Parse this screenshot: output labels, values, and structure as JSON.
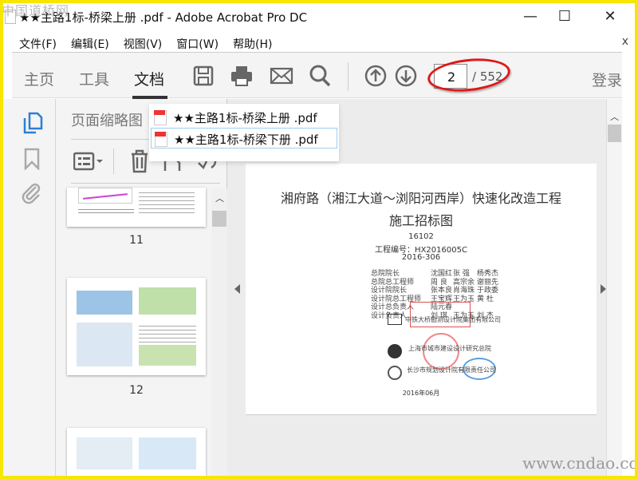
{
  "watermark_top": "中国道桥网",
  "watermark_bottom": "www.cndao.com",
  "window": {
    "title": "★★主路1标-桥梁上册 .pdf - Adobe Acrobat Pro DC",
    "minimize": "—",
    "maximize": "☐",
    "close": "✕"
  },
  "menu": [
    "文件(F)",
    "编辑(E)",
    "视图(V)",
    "窗口(W)",
    "帮助(H)"
  ],
  "menu_close": "x",
  "toolbar": {
    "tabs": [
      "主页",
      "工具",
      "文档"
    ],
    "active_tab": "文档",
    "page_current": "2",
    "page_total": "/ 552",
    "login": "登录"
  },
  "panel": {
    "title": "页面缩略图",
    "thumbnails": [
      "11",
      "12"
    ]
  },
  "tab_dropdown": [
    "★★主路1标-桥梁上册 .pdf",
    "★★主路1标-桥梁下册 .pdf"
  ],
  "document": {
    "title1": "湘府路（湘江大道～浏阳河西岸）快速化改造工程",
    "title2": "施工招标图",
    "code1": "16102",
    "code_label": "工程编号：HX2016005C",
    "code3": "2016-306",
    "credits": [
      [
        "总院院长",
        "沈国红",
        "张 强",
        "杨秀杰"
      ],
      [
        "总院总工程师",
        "周 良",
        "高宗余",
        "谢丽先"
      ],
      [
        "设计院院长",
        "张本良",
        "肖海珠",
        "于政委"
      ],
      [
        "设计院总工程师",
        "王宝辉",
        "王为玉",
        "黄 杜"
      ],
      [
        "设计总负责人",
        "陆元春",
        "",
        ""
      ],
      [
        "设计负责人",
        "刘 琪",
        "王为玉",
        "刘 杰"
      ]
    ],
    "companies": [
      "中铁大桥勘测设计院集团有限公司",
      "上海市城市建设设计研究总院",
      "长沙市规划设计院有限责任公司"
    ],
    "date": "2016年06月"
  }
}
